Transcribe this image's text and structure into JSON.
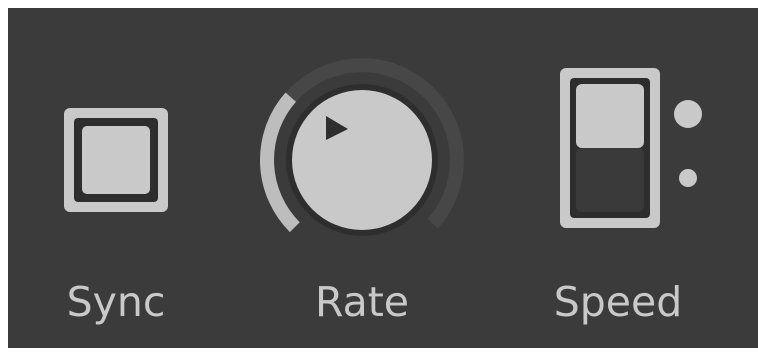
{
  "controls": {
    "sync": {
      "label": "Sync",
      "type": "toggle-button",
      "state": "off"
    },
    "rate": {
      "label": "Rate",
      "type": "knob",
      "level": 0.32
    },
    "speed": {
      "label": "Speed",
      "type": "two-position-switch",
      "options": 2,
      "selected_position": 1
    }
  },
  "colors": {
    "background": "#3b3b3b",
    "control_face": "#c9c9c9",
    "control_dark": "#2e2e2e",
    "arc_track": "#474747",
    "arc_fill": "#bdbdbd",
    "label": "#c9c9c9"
  },
  "icons": {
    "rate_indicator": "play-triangle-icon",
    "speed_position_1": "dot-icon",
    "speed_position_2": "dot-icon"
  }
}
